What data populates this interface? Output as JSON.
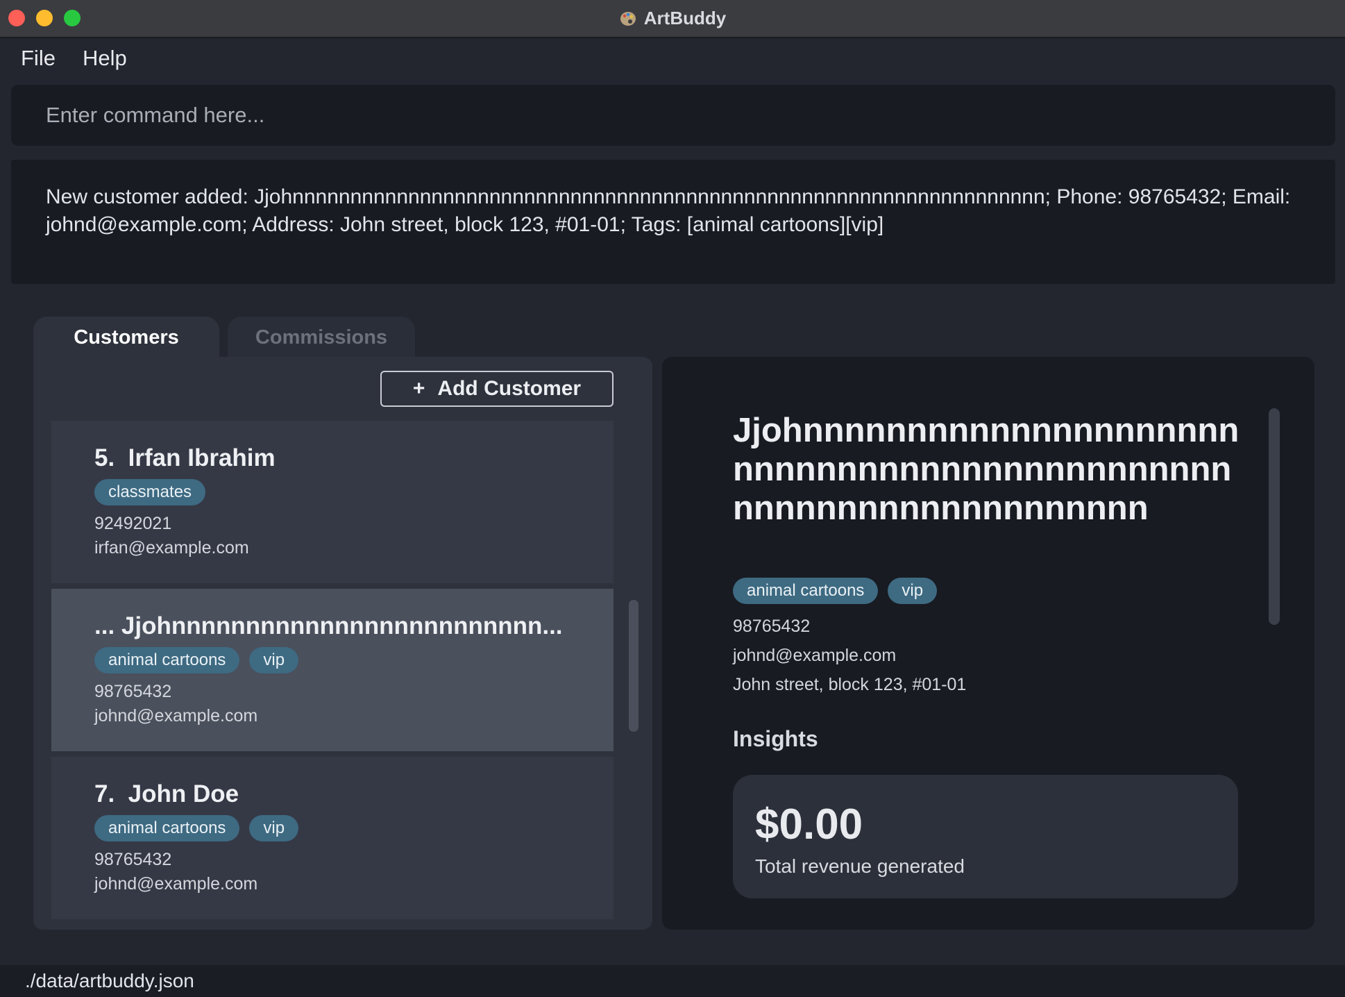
{
  "window": {
    "title": "ArtBuddy",
    "app_icon": "palette-icon"
  },
  "menu": {
    "items": [
      "File",
      "Help"
    ]
  },
  "command": {
    "placeholder": "Enter command here...",
    "value": ""
  },
  "result": {
    "text": "New customer added: Jjohnnnnnnnnnnnnnnnnnnnnnnnnnnnnnnnnnnnnnnnnnnnnnnnnnnnnnnnnnnnnnnnnn; Phone: 98765432; Email: johnd@example.com; Address: John street, block 123, #01-01; Tags: [animal cartoons][vip]"
  },
  "tabs": [
    {
      "label": "Customers",
      "active": true
    },
    {
      "label": "Commissions",
      "active": false
    }
  ],
  "list": {
    "add_button_label": "Add Customer",
    "add_button_icon": "plus-icon",
    "cards": [
      {
        "index": "5.",
        "name": "Irfan Ibrahim",
        "tags": [
          "classmates"
        ],
        "phone": "92492021",
        "email": "irfan@example.com",
        "selected": false
      },
      {
        "index": "...",
        "name": "Jjohnnnnnnnnnnnnnnnnnnnnnnnnn...",
        "tags": [
          "animal cartoons",
          "vip"
        ],
        "phone": "98765432",
        "email": "johnd@example.com",
        "selected": true
      },
      {
        "index": "7.",
        "name": "John Doe",
        "tags": [
          "animal cartoons",
          "vip"
        ],
        "phone": "98765432",
        "email": "johnd@example.com",
        "selected": false
      }
    ]
  },
  "detail": {
    "name": "Jjohnnnnnnnnnnnnnnnnnnnnnnnnnnnnnnnnnnnnnnnnnnnnnnnnnnnnnnnnnnnnnnnnn",
    "tags": [
      "animal cartoons",
      "vip"
    ],
    "phone": "98765432",
    "email": "johnd@example.com",
    "address": "John street, block 123, #01-01",
    "insights_title": "Insights",
    "revenue_value": "$0.00",
    "revenue_label": "Total revenue generated"
  },
  "status": {
    "path": "./data/artbuddy.json"
  },
  "colors": {
    "background": "#23262f",
    "panel": "#2e323c",
    "selected_card": "#4a505c",
    "tag": "#3e6a82",
    "detail_bg": "#181b22"
  }
}
